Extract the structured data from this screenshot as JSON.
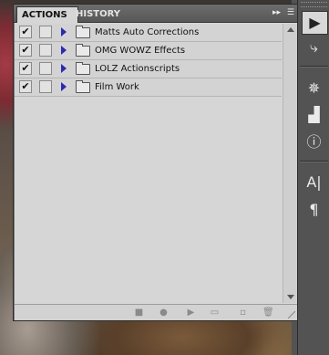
{
  "tabs": {
    "actions": "ACTIONS",
    "history": "HISTORY",
    "menu_icon": "panel-menu-icon"
  },
  "actions": [
    {
      "name": "Matts Auto Corrections",
      "checked": true
    },
    {
      "name": "OMG WOWZ Effects",
      "checked": true
    },
    {
      "name": "LOLZ Actionscripts",
      "checked": true
    },
    {
      "name": "Film Work",
      "checked": true
    }
  ],
  "check_mark": "✔",
  "footer_icons": [
    "stop-icon",
    "record-icon",
    "play-icon",
    "new-set-icon",
    "new-action-icon",
    "delete-icon"
  ],
  "dock_icons": [
    "actions-icon",
    "history-icon",
    "navigator-icon",
    "histogram-icon",
    "info-icon",
    "character-icon",
    "paragraph-icon"
  ]
}
